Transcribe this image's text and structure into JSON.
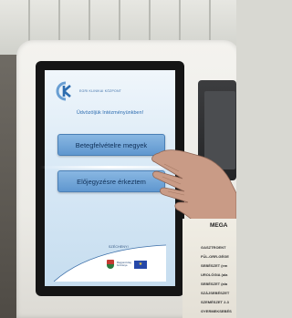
{
  "screen": {
    "logo_text": "EGRI KLINIKAI KÖZPONT",
    "welcome_text": "Üdvözöljük Intézményünkben!",
    "buttons": [
      {
        "label": "Betegfelvételre megyek"
      },
      {
        "label": "Előjegyzésre érkeztem"
      }
    ],
    "footer": {
      "program_name": "SZÉCHENYI",
      "funding_text": "Magyarország Kormánya",
      "eu_label": "★"
    }
  },
  "notice": {
    "title": "MEGA",
    "lines": [
      "GASZTROENT",
      "FÜL-ORR-GÉGE",
      "SEBÉSZET (em",
      "UROLÓGIA (ala",
      "SEBÉSZET (ala",
      "SZÁJSEBÉSZET",
      "SZEMÉSZET 2-3",
      "GYERMEKSEBÉS"
    ]
  },
  "colors": {
    "button_fill": "#6fa4d8",
    "brand_blue": "#2d6db0",
    "bezel": "#151515",
    "housing": "#f1f0ec"
  }
}
